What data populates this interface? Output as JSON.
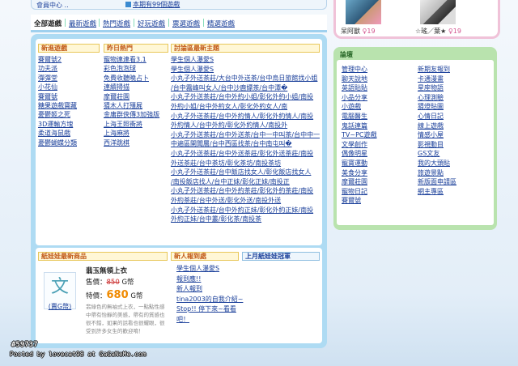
{
  "top_strip": {
    "left_text": "會員中心 ‥",
    "link": "本期有99個遊戲"
  },
  "profiles": [
    {
      "name": "呆阿獸",
      "age": "19"
    },
    {
      "name": "☆瑤／葉★",
      "age": "19"
    }
  ],
  "tabs": [
    "全部遊戲",
    "最新遊戲",
    "熱門遊戲",
    "好玩遊戲",
    "票選遊戲",
    "精選遊戲"
  ],
  "new_games": {
    "title": "新進遊戲",
    "items": [
      "賽爾號2",
      "功夫派",
      "彈彈堂",
      "小花仙",
      "賽爾號",
      "糖果遊戲寶藏",
      "憂鬱姬之死",
      "3D運輸方塊",
      "柔道海鼠戲",
      "憂鬱蝴蝶分類"
    ]
  },
  "hot_yesterday": {
    "title": "昨日熱門",
    "items": [
      "寵物連連看3.1",
      "彩色泡泡球",
      "免費收聽曉占卜",
      "連續掃描",
      "摩爾莊園",
      "猜木人打殭屍",
      "金庸群俠傳3加強版",
      "上海王照衝將",
      "上海麻將",
      "西洋跳棋"
    ]
  },
  "forum_topics": {
    "title": "討論區最新主題",
    "items": [
      "學生個人瀑愛S",
      "學生個人瀑愛S",
      "小丸子外送茶莊/大台中外送茶/台中烏日旅館找小姐",
      "/台中霧峰叫女人/台中沙鹿嫖茶/台中潭�",
      "小丸子外送茶莊/台中外約小姐/彰化外約小姐/南投",
      "外約小姐/台中外約女人/彰化外約女人/南",
      "小丸子外送茶莊/台中外約情人/彰化外約情人/南投",
      "外約情人/台中外約/彰化外約情人/南投外",
      "小丸子外送茶莊/台中外送茶/台中一中叫茶/台中中一",
      "中遍區開聞層/台中西區找茶/台中南屯叫�",
      "小丸子外送茶莊/台中外送茶莊/彰化外送茶莊/南投",
      "外送茶莊/台中茶坊/彰化茶坊/南投茶坊",
      "小丸子外送茶莊/台中飯店找女人/彰化飯店找女人",
      "/南投飯店找人/台中正妹/彰化正妹/南投正",
      "小丸子外送茶莊/台中外約茶莊/彰化外約茶莊/南投",
      "外約茶莊/台中外送/彰化外送/南投外送",
      "小丸子外送茶莊/台中外約正妹/彰化外約正妹/南投",
      "外約正妹/台中叢/彰化茶/南投茶"
    ]
  },
  "shop": {
    "title": "紙娃娃最新商品",
    "product_title": "翡玉無領上衣",
    "orig_label": "售價：",
    "orig_price": "850",
    "orig_unit": "G幣",
    "sale_label": "特價：",
    "sale_price": "680",
    "sale_unit": "G幣",
    "price_tag": "(賣G幣)",
    "desc": "翡綠色的無袖式上衣，一點點性感中帶有怡靜的美感，帶有的質感也很不錯，如果的話看也很耀眼，很受到許多女生的歡迎唷！"
  },
  "news": {
    "title": "新人報到處",
    "items": [
      "學生個人瀑愛S",
      "報到應!!",
      "新人報到",
      "tina2003的自我介紹~",
      "Stop!! 停下來~看看",
      "吧！"
    ]
  },
  "paperdoll_queen": {
    "title": "上月紙娃娃冠軍"
  },
  "forum_panel": {
    "title": "論壇",
    "left": [
      "管理中心",
      "聊天說地",
      "英語貼貼",
      "小品分享",
      "小遊戲",
      "電腦醫生",
      "鬼話連篇",
      "TV~PC遊戲",
      "文學創作",
      "偶像明星",
      "寵寶運動",
      "美食分享",
      "摩爾莊園",
      "寵物日記",
      "賽爾號"
    ],
    "right": [
      "新期友報到",
      "卡通漫畫",
      "星座物語",
      "心理測驗",
      "猜燈貼圖",
      "心情日記",
      "線上遊戲",
      "情感小屋",
      "影視動目",
      "GS文友",
      "我的大頭貼",
      "旅遊景點",
      "新版面申請區",
      "網主專區"
    ]
  },
  "watermark": {
    "id": "#59737",
    "posted": "Posted by lovecat98 at GaGaNeMe.com"
  }
}
